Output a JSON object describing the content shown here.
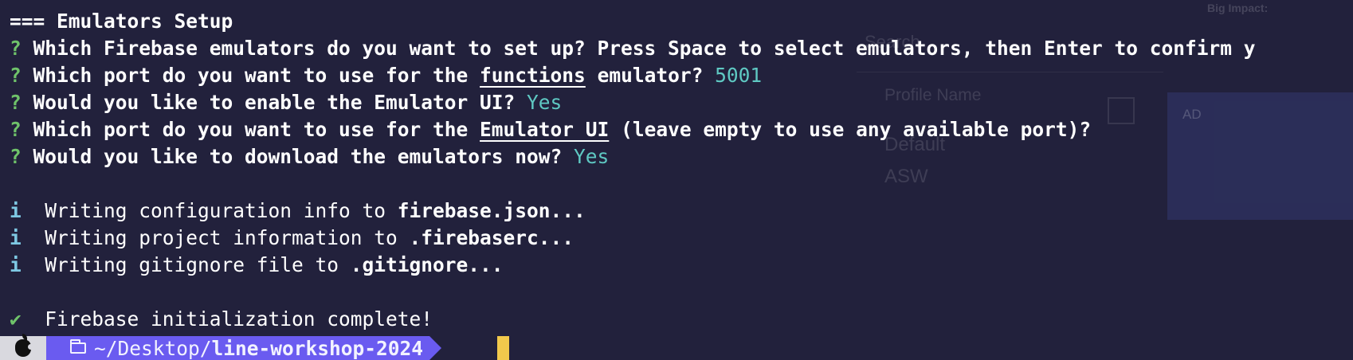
{
  "terminal": {
    "lines": {
      "l0": {
        "text": "=== Emulators Setup"
      },
      "l1": {
        "mark": "?",
        "text": "Which Firebase emulators do you want to set up? Press Space to select emulators, then Enter to confirm y"
      },
      "l2": {
        "mark": "?",
        "pre": "Which port do you want to use for the ",
        "em": "functions",
        "post": " emulator? ",
        "answer": "5001"
      },
      "l3": {
        "mark": "?",
        "pre": "Would you like to enable the Emulator UI? ",
        "answer": "Yes"
      },
      "l4": {
        "mark": "?",
        "pre": "Which port do you want to use for the ",
        "em": "Emulator UI",
        "post": " (leave empty to use any available port)?"
      },
      "l5": {
        "mark": "?",
        "pre": "Would you like to download the emulators now? ",
        "answer": "Yes"
      },
      "l6": {
        "mark": "i",
        "pre": "  Writing configuration info to ",
        "em": "firebase.json..."
      },
      "l7": {
        "mark": "i",
        "pre": "  Writing project information to ",
        "em": ".firebaserc..."
      },
      "l8": {
        "mark": "i",
        "pre": "  Writing gitignore file to ",
        "em": ".gitignore..."
      },
      "l9": {
        "mark": "✔",
        "pre": "  Firebase initialization complete!"
      }
    }
  },
  "prompt": {
    "path_prefix": "~/Desktop/",
    "path_dir": "line-workshop-2024",
    "icons": {
      "os": "apple-icon",
      "folder": "folder-icon"
    },
    "colors": {
      "os_segment": "#d9d9df",
      "path_segment": "#6a5bf0",
      "cursor": "#f2c94c"
    }
  },
  "background_window": {
    "search_label": "Search",
    "profile_header": "Profile Name",
    "profile_default": "Default",
    "profile_asw": "ASW",
    "impact_label": "Big Impact:",
    "ad_label": "AD"
  },
  "theme": {
    "background": "#22213c",
    "question_mark": "#6fc36a",
    "info_mark": "#7ec8e3",
    "answer": "#5fc9c3"
  }
}
